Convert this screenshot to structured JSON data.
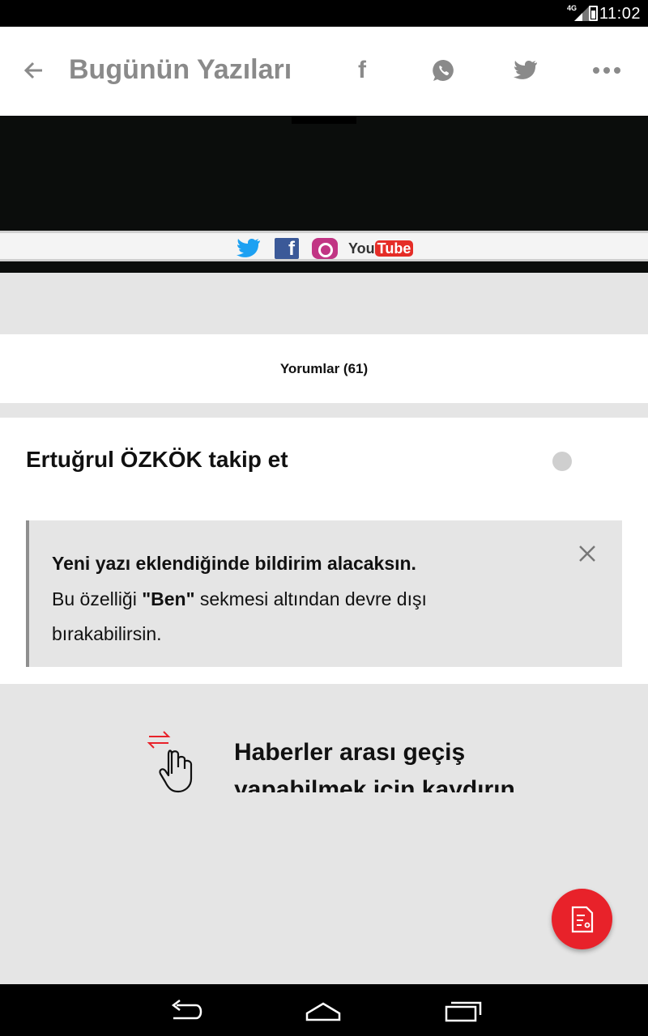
{
  "status_bar": {
    "network": "4G",
    "time": "11:02"
  },
  "toolbar": {
    "title": "Bugünün Yazıları",
    "facebook_glyph": "f",
    "icons": [
      "back-arrow-icon",
      "facebook-icon",
      "whatsapp-icon",
      "twitter-icon",
      "more-icon"
    ]
  },
  "banner": {
    "youtube_text_you": "You",
    "youtube_text_tube": "Tube",
    "facebook_glyph": "f"
  },
  "comments": {
    "label": "Yorumlar (61)"
  },
  "follow": {
    "label": "Ertuğrul ÖZKÖK takip et",
    "enabled": false
  },
  "info": {
    "headline": "Yeni yazı eklendiğinde bildirim alacaksın.",
    "line2_prefix": "Bu özelliği ",
    "line2_bold": "\"Ben\"",
    "line2_suffix": " sekmesi altından devre dışı",
    "line3": "bırakabilirsin."
  },
  "swipe_hint": {
    "text": "Haberler arası geçiş yapabilmek için kaydırın"
  },
  "colors": {
    "accent": "#e8222a",
    "toolbar_icon": "#8a8a8a",
    "background": "#e5e5e5"
  }
}
